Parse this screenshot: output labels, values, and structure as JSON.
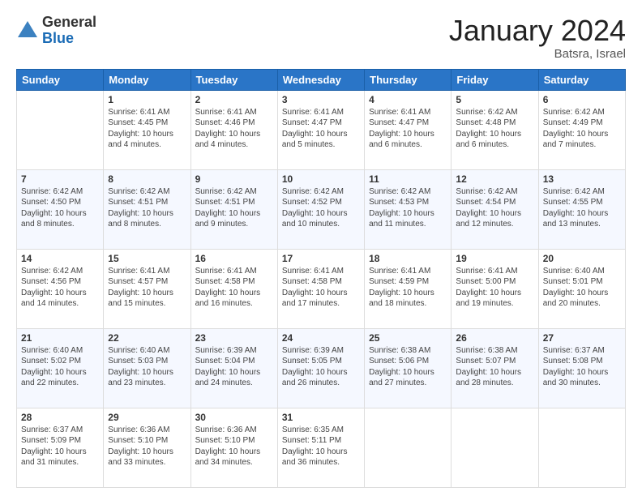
{
  "logo": {
    "general": "General",
    "blue": "Blue"
  },
  "header": {
    "title": "January 2024",
    "location": "Batsra, Israel"
  },
  "columns": [
    "Sunday",
    "Monday",
    "Tuesday",
    "Wednesday",
    "Thursday",
    "Friday",
    "Saturday"
  ],
  "weeks": [
    [
      {
        "day": "",
        "info": ""
      },
      {
        "day": "1",
        "info": "Sunrise: 6:41 AM\nSunset: 4:45 PM\nDaylight: 10 hours\nand 4 minutes."
      },
      {
        "day": "2",
        "info": "Sunrise: 6:41 AM\nSunset: 4:46 PM\nDaylight: 10 hours\nand 4 minutes."
      },
      {
        "day": "3",
        "info": "Sunrise: 6:41 AM\nSunset: 4:47 PM\nDaylight: 10 hours\nand 5 minutes."
      },
      {
        "day": "4",
        "info": "Sunrise: 6:41 AM\nSunset: 4:47 PM\nDaylight: 10 hours\nand 6 minutes."
      },
      {
        "day": "5",
        "info": "Sunrise: 6:42 AM\nSunset: 4:48 PM\nDaylight: 10 hours\nand 6 minutes."
      },
      {
        "day": "6",
        "info": "Sunrise: 6:42 AM\nSunset: 4:49 PM\nDaylight: 10 hours\nand 7 minutes."
      }
    ],
    [
      {
        "day": "7",
        "info": "Sunrise: 6:42 AM\nSunset: 4:50 PM\nDaylight: 10 hours\nand 8 minutes."
      },
      {
        "day": "8",
        "info": "Sunrise: 6:42 AM\nSunset: 4:51 PM\nDaylight: 10 hours\nand 8 minutes."
      },
      {
        "day": "9",
        "info": "Sunrise: 6:42 AM\nSunset: 4:51 PM\nDaylight: 10 hours\nand 9 minutes."
      },
      {
        "day": "10",
        "info": "Sunrise: 6:42 AM\nSunset: 4:52 PM\nDaylight: 10 hours\nand 10 minutes."
      },
      {
        "day": "11",
        "info": "Sunrise: 6:42 AM\nSunset: 4:53 PM\nDaylight: 10 hours\nand 11 minutes."
      },
      {
        "day": "12",
        "info": "Sunrise: 6:42 AM\nSunset: 4:54 PM\nDaylight: 10 hours\nand 12 minutes."
      },
      {
        "day": "13",
        "info": "Sunrise: 6:42 AM\nSunset: 4:55 PM\nDaylight: 10 hours\nand 13 minutes."
      }
    ],
    [
      {
        "day": "14",
        "info": "Sunrise: 6:42 AM\nSunset: 4:56 PM\nDaylight: 10 hours\nand 14 minutes."
      },
      {
        "day": "15",
        "info": "Sunrise: 6:41 AM\nSunset: 4:57 PM\nDaylight: 10 hours\nand 15 minutes."
      },
      {
        "day": "16",
        "info": "Sunrise: 6:41 AM\nSunset: 4:58 PM\nDaylight: 10 hours\nand 16 minutes."
      },
      {
        "day": "17",
        "info": "Sunrise: 6:41 AM\nSunset: 4:58 PM\nDaylight: 10 hours\nand 17 minutes."
      },
      {
        "day": "18",
        "info": "Sunrise: 6:41 AM\nSunset: 4:59 PM\nDaylight: 10 hours\nand 18 minutes."
      },
      {
        "day": "19",
        "info": "Sunrise: 6:41 AM\nSunset: 5:00 PM\nDaylight: 10 hours\nand 19 minutes."
      },
      {
        "day": "20",
        "info": "Sunrise: 6:40 AM\nSunset: 5:01 PM\nDaylight: 10 hours\nand 20 minutes."
      }
    ],
    [
      {
        "day": "21",
        "info": "Sunrise: 6:40 AM\nSunset: 5:02 PM\nDaylight: 10 hours\nand 22 minutes."
      },
      {
        "day": "22",
        "info": "Sunrise: 6:40 AM\nSunset: 5:03 PM\nDaylight: 10 hours\nand 23 minutes."
      },
      {
        "day": "23",
        "info": "Sunrise: 6:39 AM\nSunset: 5:04 PM\nDaylight: 10 hours\nand 24 minutes."
      },
      {
        "day": "24",
        "info": "Sunrise: 6:39 AM\nSunset: 5:05 PM\nDaylight: 10 hours\nand 26 minutes."
      },
      {
        "day": "25",
        "info": "Sunrise: 6:38 AM\nSunset: 5:06 PM\nDaylight: 10 hours\nand 27 minutes."
      },
      {
        "day": "26",
        "info": "Sunrise: 6:38 AM\nSunset: 5:07 PM\nDaylight: 10 hours\nand 28 minutes."
      },
      {
        "day": "27",
        "info": "Sunrise: 6:37 AM\nSunset: 5:08 PM\nDaylight: 10 hours\nand 30 minutes."
      }
    ],
    [
      {
        "day": "28",
        "info": "Sunrise: 6:37 AM\nSunset: 5:09 PM\nDaylight: 10 hours\nand 31 minutes."
      },
      {
        "day": "29",
        "info": "Sunrise: 6:36 AM\nSunset: 5:10 PM\nDaylight: 10 hours\nand 33 minutes."
      },
      {
        "day": "30",
        "info": "Sunrise: 6:36 AM\nSunset: 5:10 PM\nDaylight: 10 hours\nand 34 minutes."
      },
      {
        "day": "31",
        "info": "Sunrise: 6:35 AM\nSunset: 5:11 PM\nDaylight: 10 hours\nand 36 minutes."
      },
      {
        "day": "",
        "info": ""
      },
      {
        "day": "",
        "info": ""
      },
      {
        "day": "",
        "info": ""
      }
    ]
  ]
}
